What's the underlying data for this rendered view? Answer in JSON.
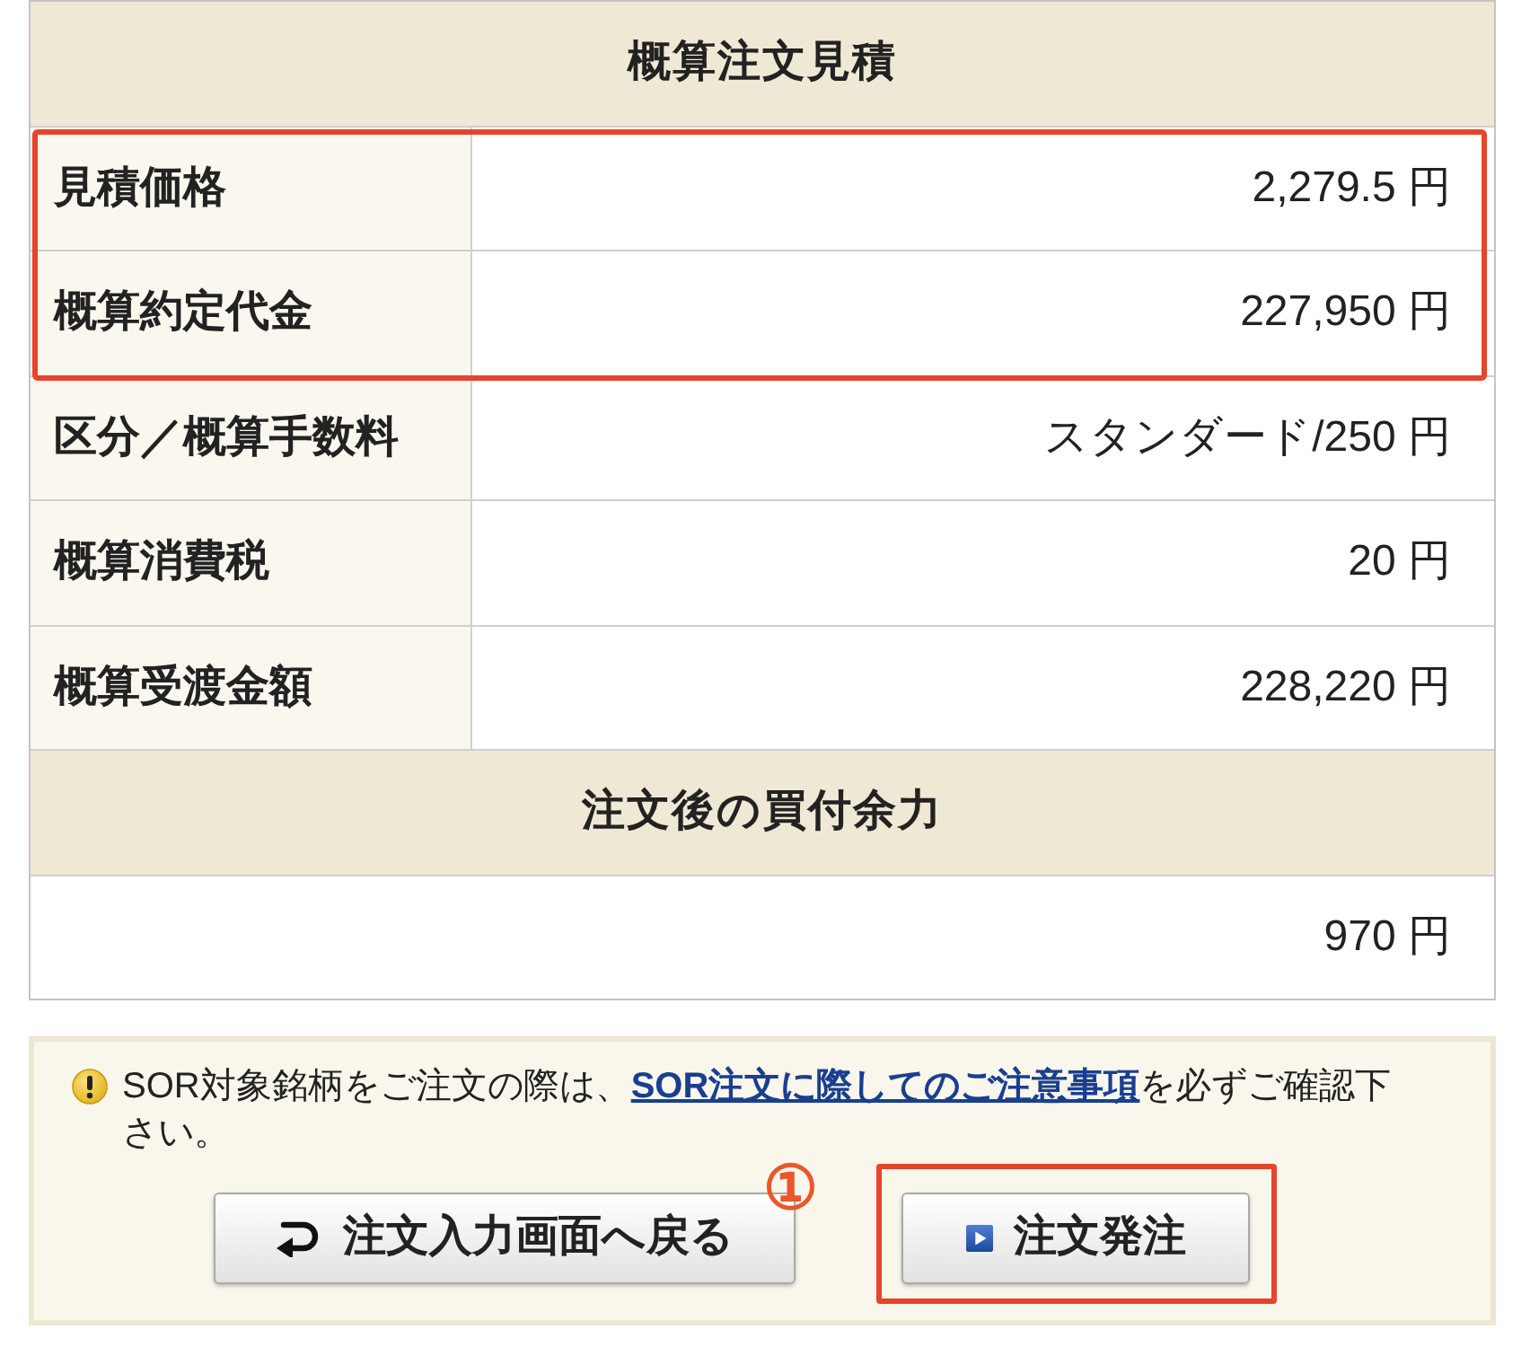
{
  "estimate": {
    "title": "概算注文見積",
    "rows": [
      {
        "label": "見積価格",
        "value": "2,279.5 円",
        "highlighted": true
      },
      {
        "label": "概算約定代金",
        "value": "227,950 円",
        "highlighted": true
      },
      {
        "label": "区分／概算手数料",
        "value": "スタンダード/250 円",
        "highlighted": false
      },
      {
        "label": "概算消費税",
        "value": "20 円",
        "highlighted": false
      },
      {
        "label": "概算受渡金額",
        "value": "228,220 円",
        "highlighted": false
      }
    ]
  },
  "buying_power": {
    "title": "注文後の買付余力",
    "value": "970 円"
  },
  "notice": {
    "text_before": "SOR対象銘柄をご注文の際は、",
    "link": "SOR注文に際してのご注意事項",
    "text_after": "を必ずご確認下さい。"
  },
  "buttons": [
    {
      "kind": "back",
      "label": "注文入力画面へ戻る",
      "highlighted": false
    },
    {
      "kind": "submit",
      "label": "注文発注",
      "highlighted": true,
      "step_marker": "①"
    }
  ]
}
